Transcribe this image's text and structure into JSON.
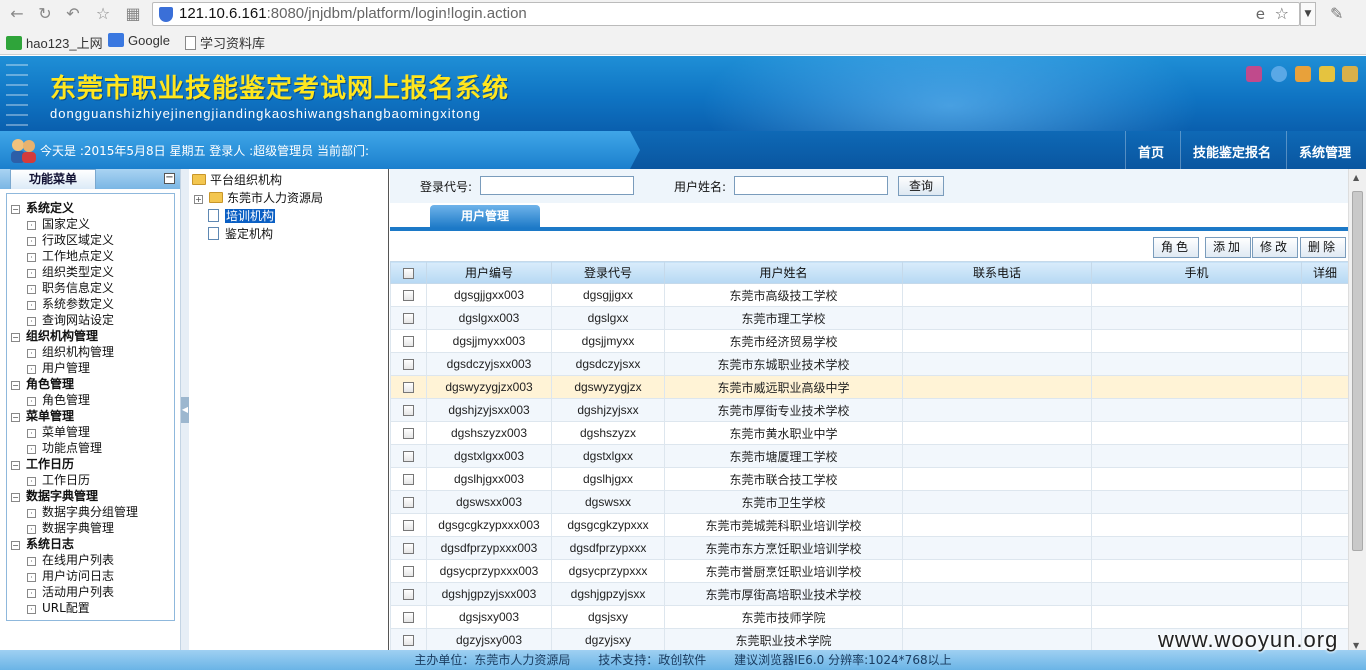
{
  "browser": {
    "url_host": "121.10.6.161",
    "url_rest": ":8080/jnjdbm/platform/login!login.action",
    "bookmarks": [
      "hao123_上网",
      "Google",
      "学习资料库"
    ]
  },
  "header": {
    "title": "东莞市职业技能鉴定考试网上报名系统",
    "pinyin": "dongguanshizhiyejinengjiandingkaoshiwangshangbaomingxitong"
  },
  "status": {
    "text": "今天是 :2015年5月8日  星期五  登录人 :超级管理员  当前部门:",
    "nav": [
      "首页",
      "技能鉴定报名",
      "系统管理"
    ]
  },
  "menu": {
    "title": "功能菜单",
    "groups": [
      {
        "label": "系统定义",
        "items": [
          "国家定义",
          "行政区域定义",
          "工作地点定义",
          "组织类型定义",
          "职务信息定义",
          "系统参数定义",
          "查询网站设定"
        ]
      },
      {
        "label": "组织机构管理",
        "items": [
          "组织机构管理",
          "用户管理"
        ]
      },
      {
        "label": "角色管理",
        "items": [
          "角色管理"
        ]
      },
      {
        "label": "菜单管理",
        "items": [
          "菜单管理",
          "功能点管理"
        ]
      },
      {
        "label": "工作日历",
        "items": [
          "工作日历"
        ]
      },
      {
        "label": "数据字典管理",
        "items": [
          "数据字典分组管理",
          "数据字典管理"
        ]
      },
      {
        "label": "系统日志",
        "items": [
          "在线用户列表",
          "用户访问日志",
          "活动用户列表",
          "URL配置"
        ]
      }
    ]
  },
  "tree": {
    "root": "平台组织机构",
    "nodes": [
      "东莞市人力资源局",
      "培训机构",
      "鉴定机构"
    ]
  },
  "search": {
    "code_label": "登录代号:",
    "name_label": "用户姓名:",
    "query_button": "查询"
  },
  "tab": "用户管理",
  "actions": [
    "角色",
    "添加",
    "修改",
    "删除"
  ],
  "table": {
    "headers": [
      "用户编号",
      "登录代号",
      "用户姓名",
      "联系电话",
      "手机",
      "详细"
    ],
    "rows": [
      [
        "dgsgjjgxx003",
        "dgsgjjgxx",
        "东莞市高级技工学校"
      ],
      [
        "dgslgxx003",
        "dgslgxx",
        "东莞市理工学校"
      ],
      [
        "dgsjjmyxx003",
        "dgsjjmyxx",
        "东莞市经济贸易学校"
      ],
      [
        "dgsdczyjsxx003",
        "dgsdczyjsxx",
        "东莞市东城职业技术学校"
      ],
      [
        "dgswyzygjzx003",
        "dgswyzygjzx",
        "东莞市威远职业高级中学"
      ],
      [
        "dgshjzyjsxx003",
        "dgshjzyjsxx",
        "东莞市厚街专业技术学校"
      ],
      [
        "dgshszyzx003",
        "dgshszyzx",
        "东莞市黄水职业中学"
      ],
      [
        "dgstxlgxx003",
        "dgstxlgxx",
        "东莞市塘厦理工学校"
      ],
      [
        "dgslhjgxx003",
        "dgslhjgxx",
        "东莞市联合技工学校"
      ],
      [
        "dgswsxx003",
        "dgswsxx",
        "东莞市卫生学校"
      ],
      [
        "dgsgcgkzypxxx003",
        "dgsgcgkzypxxx",
        "东莞市莞城莞科职业培训学校"
      ],
      [
        "dgsdfprzypxxx003",
        "dgsdfprzypxxx",
        "东莞市东方烹饪职业培训学校"
      ],
      [
        "dgsycprzypxxx003",
        "dgsycprzypxxx",
        "东莞市誉厨烹饪职业培训学校"
      ],
      [
        "dgshjgpzyjsxx003",
        "dgshjgpzyjsxx",
        "东莞市厚街高培职业技术学校"
      ],
      [
        "dgsjsxy003",
        "dgsjsxy",
        "东莞市技师学院"
      ],
      [
        "dgzyjsxy003",
        "dgzyjsxy",
        "东莞职业技术学院"
      ]
    ]
  },
  "footer": [
    "主办单位：东莞市人力资源局",
    "技术支持：政创软件",
    "建议浏览器IE6.0 分辨率:1024*768以上"
  ],
  "watermark": "www.wooyun.org",
  "colors": {
    "banner": "#0f74c3",
    "title": "#ffe61e",
    "highlight_row": "#fff3d6"
  }
}
